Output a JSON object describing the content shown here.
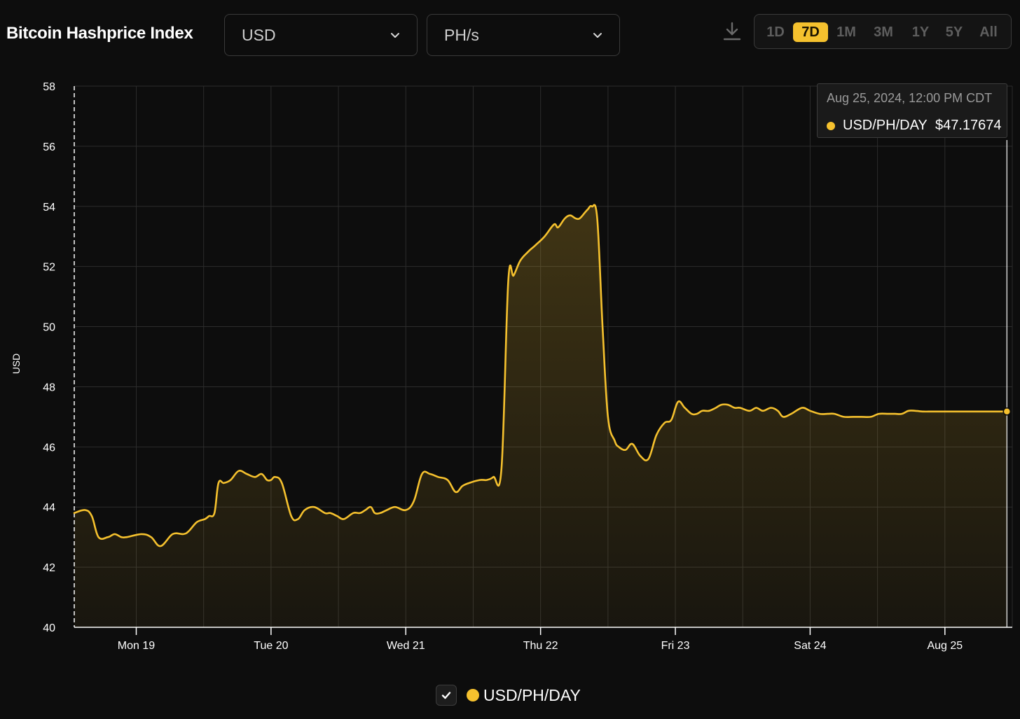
{
  "header": {
    "title": "Bitcoin Hashprice Index",
    "currency_select": "USD",
    "unit_select": "PH/s",
    "ranges": [
      "1D",
      "7D",
      "1M",
      "3M",
      "1Y",
      "5Y",
      "All"
    ],
    "active_range": "7D"
  },
  "tooltip": {
    "date": "Aug 25, 2024, 12:00 PM CDT",
    "label": "USD/PH/DAY",
    "value": "$47.17674"
  },
  "legend": {
    "label": "USD/PH/DAY",
    "checked": true
  },
  "colors": {
    "background": "#0d0d0d",
    "accent": "#f5c12e",
    "line": "#f5c12e",
    "grid": "#2c2c2c"
  },
  "chart_data": {
    "type": "area",
    "ylabel": "USD",
    "ylim": [
      40,
      58
    ],
    "yticks": [
      40,
      42,
      44,
      46,
      48,
      50,
      52,
      54,
      56,
      58
    ],
    "xlim": [
      -0.46,
      6.5
    ],
    "xticks": [
      {
        "x": 0,
        "label": "Mon 19"
      },
      {
        "x": 1,
        "label": "Tue 20"
      },
      {
        "x": 2,
        "label": "Wed 21"
      },
      {
        "x": 3,
        "label": "Thu 22"
      },
      {
        "x": 4,
        "label": "Fri 23"
      },
      {
        "x": 5,
        "label": "Sat 24"
      },
      {
        "x": 6,
        "label": "Aug 25"
      }
    ],
    "x_unit": "days (0 = Mon 19)",
    "grid": true,
    "series": [
      {
        "name": "USD/PH/DAY",
        "x": [
          -0.46,
          -0.38,
          -0.33,
          -0.28,
          -0.21,
          -0.16,
          -0.11,
          -0.07,
          0.04,
          0.11,
          0.18,
          0.27,
          0.35,
          0.39,
          0.45,
          0.51,
          0.54,
          0.58,
          0.61,
          0.65,
          0.7,
          0.76,
          0.82,
          0.88,
          0.93,
          0.97,
          1.0,
          1.03,
          1.08,
          1.15,
          1.2,
          1.25,
          1.32,
          1.4,
          1.44,
          1.49,
          1.54,
          1.61,
          1.66,
          1.7,
          1.74,
          1.77,
          1.81,
          1.86,
          1.92,
          2.0,
          2.06,
          2.12,
          2.18,
          2.24,
          2.31,
          2.37,
          2.42,
          2.47,
          2.55,
          2.6,
          2.65,
          2.71,
          2.76,
          2.8,
          2.85,
          2.91,
          2.96,
          3.03,
          3.1,
          3.13,
          3.18,
          3.22,
          3.26,
          3.29,
          3.33,
          3.35,
          3.38,
          3.42,
          3.46,
          3.5,
          3.55,
          3.58,
          3.63,
          3.68,
          3.74,
          3.8,
          3.86,
          3.92,
          3.97,
          4.02,
          4.07,
          4.12,
          4.16,
          4.2,
          4.25,
          4.3,
          4.34,
          4.39,
          4.44,
          4.48,
          4.55,
          4.6,
          4.65,
          4.71,
          4.76,
          4.8,
          4.86,
          4.94,
          5.0,
          5.07,
          5.13,
          5.18,
          5.25,
          5.32,
          5.38,
          5.45,
          5.51,
          5.58,
          5.63,
          5.68,
          5.73,
          5.78,
          5.84,
          5.9,
          5.96,
          6.02,
          6.08,
          6.14,
          6.21,
          6.27,
          6.34,
          6.39,
          6.42,
          6.46
        ],
        "values": [
          43.8,
          43.9,
          43.7,
          43.0,
          43.0,
          43.1,
          43.0,
          43.0,
          43.1,
          43.0,
          42.7,
          43.1,
          43.1,
          43.2,
          43.5,
          43.6,
          43.7,
          43.8,
          44.8,
          44.8,
          44.9,
          45.2,
          45.1,
          45.0,
          45.1,
          44.9,
          44.9,
          45.0,
          44.8,
          43.7,
          43.6,
          43.9,
          44.0,
          43.8,
          43.8,
          43.7,
          43.6,
          43.8,
          43.8,
          43.9,
          44.0,
          43.8,
          43.8,
          43.9,
          44.0,
          43.9,
          44.2,
          45.1,
          45.1,
          45.0,
          44.9,
          44.5,
          44.7,
          44.8,
          44.9,
          44.9,
          45.0,
          45.3,
          51.5,
          51.7,
          52.2,
          52.5,
          52.7,
          53.0,
          53.4,
          53.3,
          53.6,
          53.7,
          53.6,
          53.6,
          53.8,
          53.9,
          54.0,
          53.6,
          50.0,
          47.0,
          46.2,
          46.0,
          45.9,
          46.1,
          45.7,
          45.6,
          46.4,
          46.8,
          46.9,
          47.5,
          47.3,
          47.1,
          47.1,
          47.2,
          47.2,
          47.3,
          47.4,
          47.4,
          47.3,
          47.3,
          47.2,
          47.3,
          47.2,
          47.3,
          47.2,
          47.0,
          47.1,
          47.3,
          47.2,
          47.1,
          47.1,
          47.1,
          47.0,
          47.0,
          47.0,
          47.0,
          47.1,
          47.1,
          47.1,
          47.1,
          47.2,
          47.2,
          47.17674,
          47.17674,
          47.17674,
          47.17674,
          47.17674,
          47.17674,
          47.17674,
          47.17674,
          47.17674,
          47.17674,
          47.17674,
          47.17674
        ]
      }
    ]
  }
}
